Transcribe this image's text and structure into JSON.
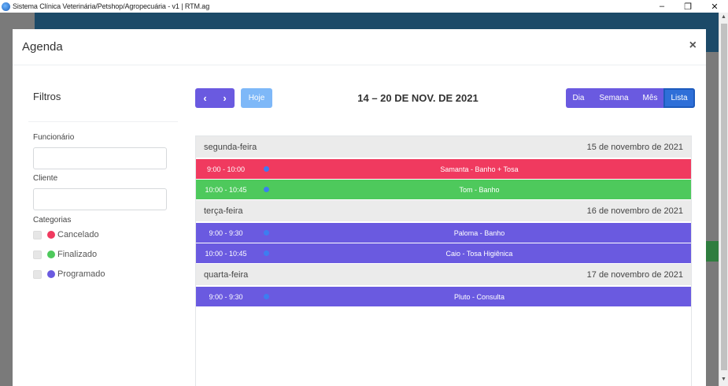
{
  "window": {
    "title": "Sistema Clínica Veterinária/Petshop/Agropecuária - v1 | RTM.ag",
    "minimize": "–",
    "restore": "❐",
    "close": "✕"
  },
  "modal": {
    "title": "Agenda",
    "close": "×"
  },
  "sidebar": {
    "title": "Filtros",
    "employee_label": "Funcionário",
    "employee_value": "",
    "client_label": "Cliente",
    "client_value": "",
    "categories_label": "Categorias",
    "categories": [
      {
        "label": "Cancelado",
        "color": "#f03a5f"
      },
      {
        "label": "Finalizado",
        "color": "#4ec95c"
      },
      {
        "label": "Programado",
        "color": "#6a5ae0"
      }
    ]
  },
  "toolbar": {
    "prev": "‹",
    "next": "›",
    "today": "Hoje",
    "range": "14 – 20 DE NOV. DE 2021",
    "views": [
      "Dia",
      "Semana",
      "Mês",
      "Lista"
    ],
    "active_view": "Lista"
  },
  "colors": {
    "primary": "#6a5ae0",
    "today": "#7eb8f8",
    "active_view": "#2e6fd8",
    "event_dot": "#3d7df0"
  },
  "days": [
    {
      "name": "segunda-feira",
      "date": "15 de novembro de 2021",
      "events": [
        {
          "time": "9:00 - 10:00",
          "title": "Samanta - Banho + Tosa",
          "color": "#f03a5f"
        },
        {
          "time": "10:00 - 10:45",
          "title": "Tom - Banho",
          "color": "#4ec95c"
        }
      ]
    },
    {
      "name": "terça-feira",
      "date": "16 de novembro de 2021",
      "events": [
        {
          "time": "9:00 - 9:30",
          "title": "Paloma - Banho",
          "color": "#6a5ae0"
        },
        {
          "time": "10:00 - 10:45",
          "title": "Caio - Tosa Higiênica",
          "color": "#6a5ae0"
        }
      ]
    },
    {
      "name": "quarta-feira",
      "date": "17 de novembro de 2021",
      "events": [
        {
          "time": "9:00 - 9:30",
          "title": "Pluto - Consulta",
          "color": "#6a5ae0"
        }
      ]
    }
  ]
}
